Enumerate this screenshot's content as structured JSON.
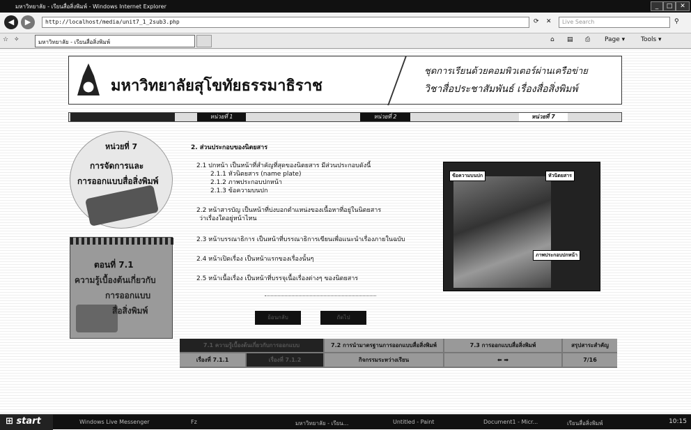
{
  "window": {
    "title": "มหาวิทยาลัย - เรียนสื่อสิ่งพิมพ์ - Windows Internet Explorer"
  },
  "browser": {
    "url": "http://localhost/media/unit7_1_2sub3.php",
    "search_placeholder": "Live Search",
    "tab_label": "มหาวิทยาลัย - เรียนสื่อสิ่งพิมพ์",
    "page_label": "Page",
    "tools_label": "Tools"
  },
  "banner": {
    "university": "มหาวิทยาลัยสุโขทัยธรรมาธิราช",
    "series": "ชุดการเรียนด้วยคอมพิวเตอร์ผ่านเครือข่าย",
    "course": "วิชาสื่อประชาสัมพันธ์ เรื่องสื่อสิ่งพิมพ์"
  },
  "unit_nav": {
    "unit1": "หน่วยที่ 1",
    "unit2": "หน่วยที่ 2",
    "current": "หน่วยที่ 7"
  },
  "left": {
    "unit_no": "หน่วยที่ 7",
    "unit_title1": "การจัดการและ",
    "unit_title2": "การออกแบบสื่อสิ่งพิมพ์",
    "topic_no": "ตอนที่ 7.1",
    "topic_t1": "ความรู้เบื้องต้นเกี่ยวกับ",
    "topic_t2": "การออกแบบ",
    "topic_t3": "สื่อสิ่งพิมพ์"
  },
  "main": {
    "heading": "2. ส่วนประกอบของนิตยสาร",
    "p21": "2.1 ปกหน้า เป็นหน้าที่สำคัญที่สุดของนิตยสาร มีส่วนประกอบดังนี้",
    "p211": "2.1.1 หัวนิตยสาร (name plate)",
    "p212": "2.1.2 ภาพประกอบปกหน้า",
    "p213": "2.1.3 ข้อความบนปก",
    "p22a": "2.2 หน้าสารบัญ เป็นหน้าที่บ่งบอกตำแหน่งของเนื้อหาที่อยู่ในนิตยสาร",
    "p22b": "ว่าเรื่องใดอยู่หน้าไหน",
    "p23": "2.3 หน้าบรรณาธิการ เป็นหน้าที่บรรณาธิการเขียนเพื่อแนะนำเรื่องภายในฉบับ",
    "p24": "2.4 หน้าเปิดเรื่อง เป็นหน้าแรกของเรื่องนั้นๆ",
    "p25": "2.5 หน้าเนื้อเรื่อง เป็นหน้าที่บรรจุเนื้อเรื่องต่างๆ ของนิตยสาร",
    "prev": "ย้อนกลับ",
    "next": "ถัดไป"
  },
  "photo": {
    "label_cover_text": "ข้อความบนปก",
    "label_nameplate": "หัวนิตยสาร",
    "label_cover_image": "ภาพประกอบปกหน้า"
  },
  "bottom_nav": {
    "t71": "7.1 ความรู้เบื้องต้นเกี่ยวกับการออกแบบ",
    "t72": "7.2 การนำมาตรฐานการออกแบบสื่อสิ่งพิมพ์",
    "t73": "7.3 การออกแบบสื่อสิ่งพิมพ์",
    "summary": "สรุปสาระสำคัญ",
    "topic": "เรื่องที่ 7.1.1",
    "topic2": "เรื่องที่ 7.1.2",
    "activity": "กิจกรรมระหว่างเรียน",
    "page": "7/16"
  },
  "taskbar": {
    "start": "start",
    "tasks": [
      "Windows Live Messenger",
      "Fz",
      "มหาวิทยาลัย - เรียน...",
      "Untitled - Paint",
      "Document1 - Micr...",
      "เรียนสื่อสิ่งพิมพ์"
    ],
    "clock": "10:15"
  }
}
